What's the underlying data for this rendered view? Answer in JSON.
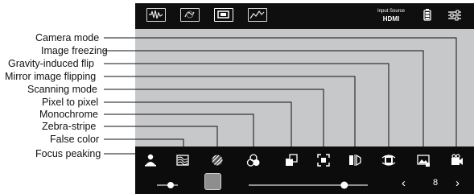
{
  "callouts": [
    "Camera mode",
    "Image freezing",
    "Gravity-induced flip",
    "Mirror image flipping",
    "Scanning mode",
    "Pixel to pixel",
    "Monochrome",
    "Zebra-stripe",
    "False color",
    "Focus peaking"
  ],
  "top_bar": {
    "modes": [
      "waveform-icon",
      "vectorscope-icon",
      "frame-icon",
      "histogram-icon"
    ],
    "input_source_label": "Input Source",
    "input_source_value": "HDMI"
  },
  "bottom_bar": {
    "icons": [
      "focus-peaking-icon",
      "false-color-icon",
      "zebra-stripe-icon",
      "monochrome-icon",
      "pixel-to-pixel-icon",
      "scanning-mode-icon",
      "mirror-flip-icon",
      "gravity-flip-icon",
      "image-freeze-icon",
      "camera-mode-icon"
    ],
    "small_slider_level": 0.7,
    "main_slider_level": 0.82,
    "page_value": "8"
  },
  "colors": {
    "screen_gray": "#c7c8ca",
    "bar_black": "#0c0c0c",
    "icon_white": "#ffffff"
  }
}
